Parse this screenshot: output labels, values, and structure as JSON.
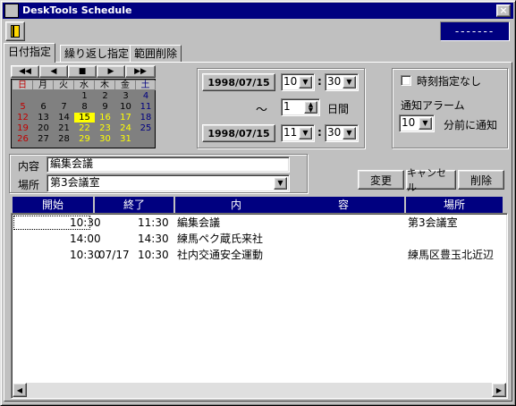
{
  "window": {
    "title": "DeskTools Schedule",
    "icon_text": "Desk Tools",
    "close": "×"
  },
  "status": {
    "text": "-------"
  },
  "tabs": [
    "日付指定",
    "繰り返し指定",
    "範囲削除"
  ],
  "nav": [
    "◀◀",
    "◀",
    "■",
    "▶",
    "▶▶"
  ],
  "calendar": {
    "headers": [
      "日",
      "月",
      "火",
      "水",
      "木",
      "金",
      "土"
    ],
    "rows": [
      [
        "",
        "",
        "",
        "1",
        "2",
        "3",
        "4"
      ],
      [
        "5",
        "6",
        "7",
        "8",
        "9",
        "10",
        "11"
      ],
      [
        "12",
        "13",
        "14",
        "15",
        "16",
        "17",
        "18"
      ],
      [
        "19",
        "20",
        "21",
        "22",
        "23",
        "24",
        "25"
      ],
      [
        "26",
        "27",
        "28",
        "29",
        "30",
        "31",
        ""
      ]
    ],
    "today": "15",
    "muted_from": "16"
  },
  "start": {
    "date": "1998/07/15",
    "hour": "10",
    "minute": "30"
  },
  "end": {
    "date": "1998/07/15",
    "hour": "11",
    "minute": "30"
  },
  "tilde": "～",
  "days": {
    "value": "1",
    "label": "日間"
  },
  "colon": ":",
  "alarm": {
    "checkbox_label": "時刻指定なし",
    "title": "通知アラーム",
    "value": "10",
    "suffix": "分前に通知"
  },
  "form": {
    "content_label": "内容",
    "content_value": "編集会議",
    "place_label": "場所",
    "place_value": "第3会議室"
  },
  "buttons": {
    "change": "変更",
    "cancel": "キャンセル",
    "delete": "削除"
  },
  "list": {
    "headers": [
      "開始",
      "終了",
      "内　　　　　　　　　容",
      "場所"
    ],
    "rows": [
      {
        "start": "10:30",
        "end_date": "",
        "end": "11:30",
        "content": "編集会議",
        "place": "第3会議室"
      },
      {
        "start": "14:00",
        "end_date": "",
        "end": "14:30",
        "content": "練馬ペク蔵氏来社",
        "place": ""
      },
      {
        "start": "10:30",
        "end_date": "07/17",
        "end": "10:30",
        "content": "社内交通安全運動",
        "place": "練馬区豊玉北近辺"
      }
    ]
  },
  "scroll": {
    "left": "◀",
    "right": "▶"
  }
}
